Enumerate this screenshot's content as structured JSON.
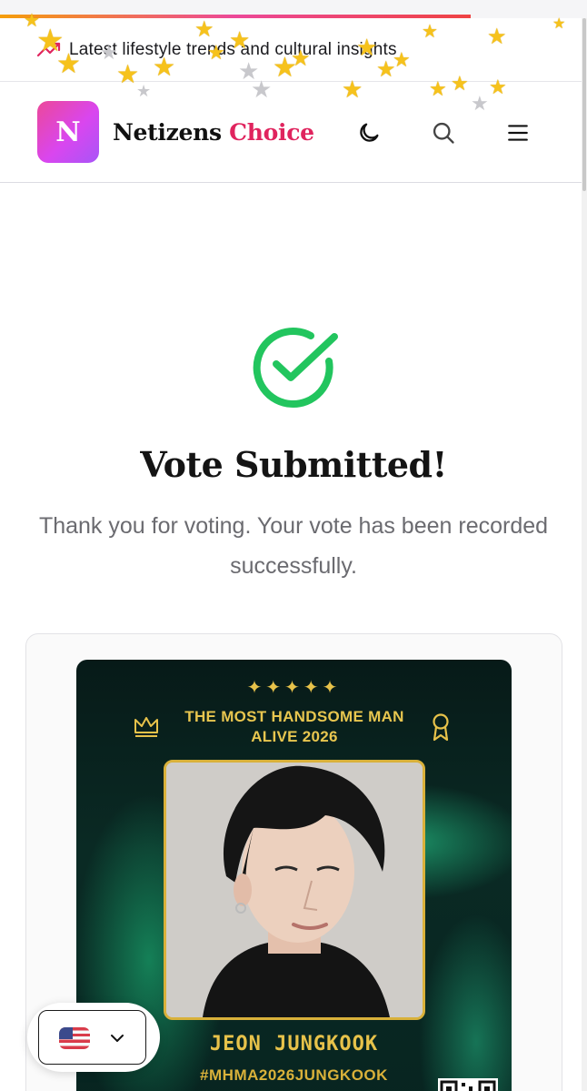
{
  "ticker": {
    "text": "Latest lifestyle trends and cultural insights",
    "icon": "trending-up-icon"
  },
  "header": {
    "logo_letter": "N",
    "brand_part1": "Netizens",
    "brand_part2": "Choice",
    "accent_color": "#e0245e",
    "icons": [
      "moon-icon",
      "search-icon",
      "menu-icon"
    ]
  },
  "confirmation": {
    "icon": "check-circle-icon",
    "title": "Vote Submitted!",
    "message": "Thank you for voting. Your vote has been recorded successfully.",
    "success_color": "#22c55e"
  },
  "poster": {
    "sparkles": "✦✦✦✦✦",
    "award_line1": "THE MOST HANDSOME MAN",
    "award_line2": "ALIVE 2026",
    "nominee_name": "JEON JUNGKOOK",
    "hashtag": "#MHMA2026JUNGKOOK",
    "gold_color": "#e7c24a"
  },
  "language_selector": {
    "flag": "us-flag-icon",
    "chevron": "chevron-down-icon"
  }
}
